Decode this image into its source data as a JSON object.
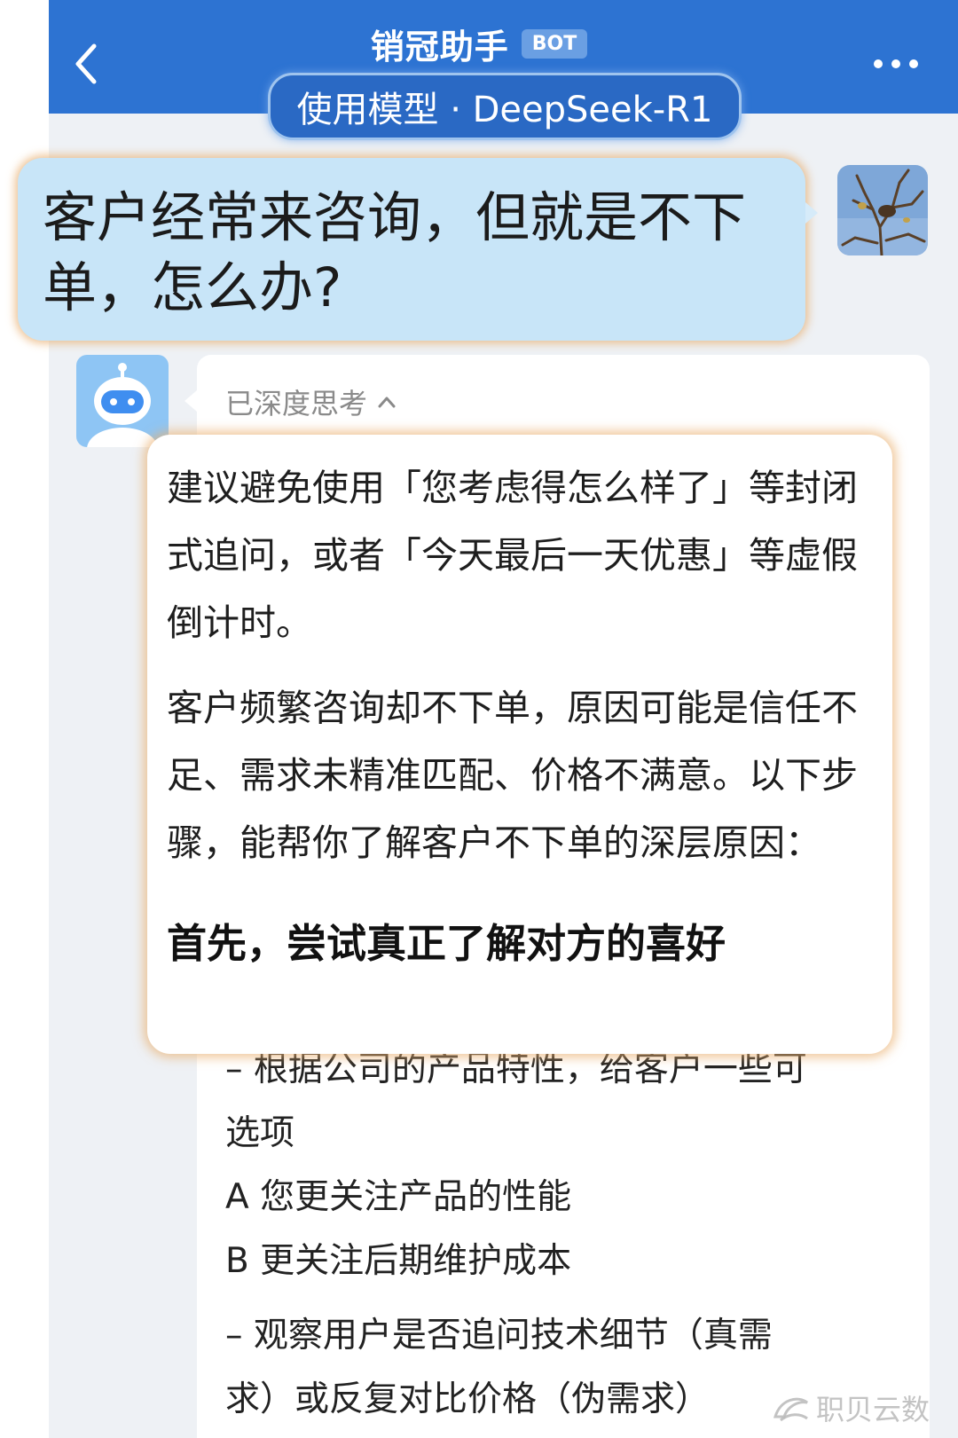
{
  "header": {
    "title": "销冠助手",
    "badge": "BOT",
    "model_pill": "使用模型 · DeepSeek-R1",
    "back_icon": "chevron-left-icon",
    "more_icon": "more-dots-icon",
    "color": "#2d73d2"
  },
  "user_message": {
    "text": "客户经常来咨询，但就是不下单，怎么办?",
    "bubble_color": "#c8e5f8"
  },
  "bot_reply": {
    "thinking_label": "已深度思考",
    "paragraphs": [
      "建议避免使用「您考虑得怎么样了」等封闭式追问，或者「今天最后一天优惠」等虚假倒计时。",
      "客户频繁咨询却不下单，原因可能是信任不足、需求未精准匹配、价格不满意。以下步骤，能帮你了解客户不下单的深层原因："
    ],
    "heading": "首先，尝试真正了解对方的喜好",
    "list_lines": [
      "– 根据公司的产品特性，给客户一些可",
      "选项",
      "A 您更关注产品的性能",
      "B 更关注后期维护成本",
      "– 观察用户是否追问技术细节（真需",
      "求）或反复对比价格（伪需求）"
    ]
  },
  "watermark": {
    "text": "职贝云数"
  }
}
